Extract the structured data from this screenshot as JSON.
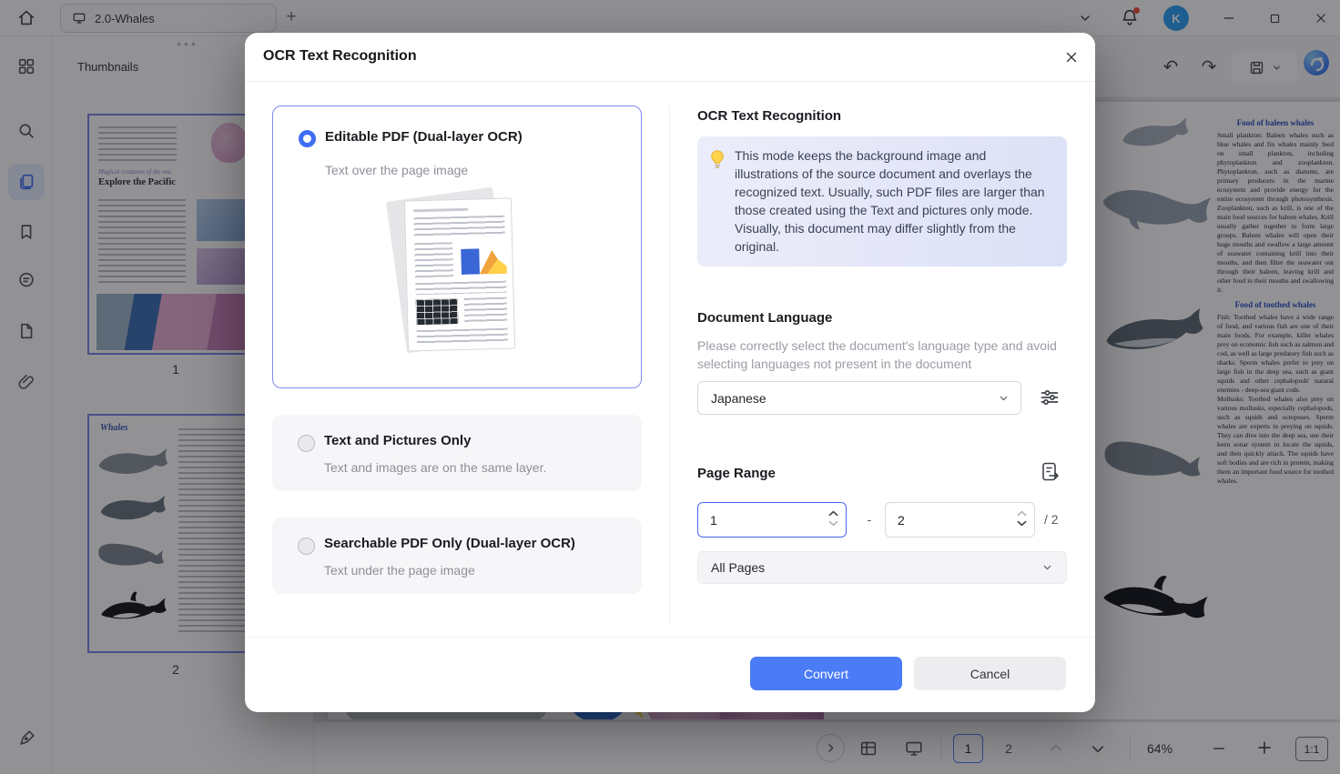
{
  "colors": {
    "accent_blue": "#4b7bf6",
    "radio_selected": "#3f6df5",
    "selected_card_border": "#8289ee",
    "thumbnail_border": "#7b86ea",
    "avatar_blue": "#2da0f5",
    "info_box": "#e7eafa"
  },
  "icons": {
    "undo": "↶",
    "redo": "↷",
    "new_tab": "+",
    "panel_handle": "•••"
  },
  "titlebar": {
    "tab_title": "2.0-Whales",
    "avatar_initial": "K"
  },
  "thumbnail_panel": {
    "title": "Thumbnails",
    "pages": [
      {
        "label": "1"
      },
      {
        "label": "2"
      }
    ]
  },
  "doc_pages": {
    "page1": {
      "script_line": "Magical creatures of the sea.",
      "title": "Explore the Pacific"
    },
    "page2": {
      "title": "Whales"
    }
  },
  "document_text": {
    "heading1": "Food of baleen whales",
    "para1": "Small plankton: Baleen whales such as blue whales and fin whales mainly feed on small plankton, including phytoplankton and zooplankton. Phytoplankton, such as diatoms, are primary producers in the marine ecosystem and provide energy for the entire ecosystem through photosynthesis. Zooplankton, such as krill, is one of the main food sources for baleen whales. Krill usually gather together to form large groups. Baleen whales will open their huge mouths and swallow a large amount of seawater containing krill into their mouths, and then filter the seawater out through their baleen, leaving krill and other food in their mouths and swallowing it.",
    "heading2": "Food of toothed whales",
    "para2": "Fish: Toothed whales have a wide range of food, and various fish are one of their main foods. For example, killer whales prey on economic fish such as salmon and cod, as well as large predatory fish such as sharks. Sperm whales prefer to prey on large fish in the deep sea, such as giant squids and other cephalopods' natural enemies - deep-sea giant cods.",
    "para3": "Mollusks: Toothed whales also prey on various mollusks, especially cephalopods, such as squids and octopuses. Sperm whales are experts in preying on squids. They can dive into the deep sea, use their keen sonar system to locate the squids, and then quickly attack. The squids have soft bodies and are rich in protein, making them an important food source for toothed whales."
  },
  "dialog": {
    "title": "OCR Text Recognition",
    "modes": [
      {
        "label": "Editable PDF (Dual-layer OCR)",
        "description": "Text over the page image",
        "selected": true
      },
      {
        "label": "Text and Pictures Only",
        "description": "Text and images are on the same layer.",
        "selected": false
      },
      {
        "label": "Searchable PDF Only (Dual-layer OCR)",
        "description": "Text under the page image",
        "selected": false
      }
    ],
    "panel": {
      "heading": "OCR Text Recognition",
      "info": "This mode keeps the background image and illustrations of the source document and overlays the recognized text. Usually, such PDF files are larger than those created using the Text and pictures only mode. Visually, this document may differ slightly from the original.",
      "language_heading": "Document Language",
      "language_hint": "Please correctly select the document's language type and avoid selecting languages not present in the document",
      "language_value": "Japanese",
      "page_range_heading": "Page Range",
      "range_from": "1",
      "range_separator": "-",
      "range_to": "2",
      "range_total": "/ 2",
      "scope_value": "All Pages",
      "convert_label": "Convert",
      "cancel_label": "Cancel"
    }
  },
  "statusbar": {
    "current_page": "1",
    "next_page": "2",
    "zoom": "64%",
    "fit": "1:1"
  }
}
